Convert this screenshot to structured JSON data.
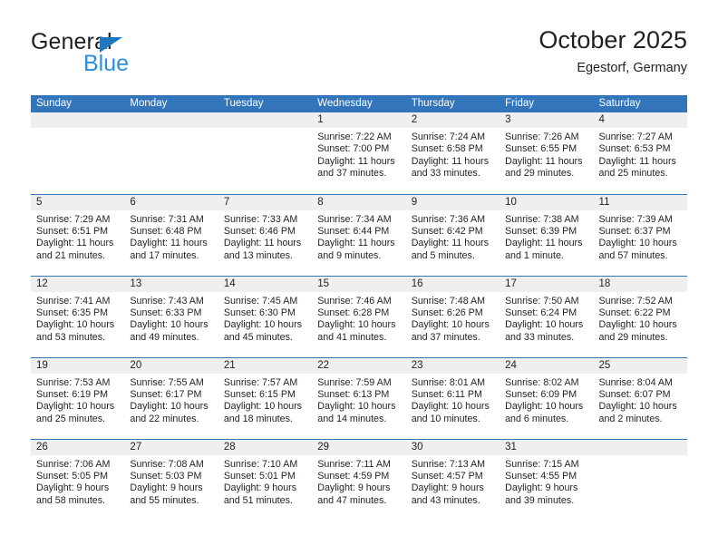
{
  "brand": {
    "word_general": "General",
    "word_blue": "Blue",
    "triangle_color": "#1f77bd",
    "blue_color": "#2f8ed6"
  },
  "header": {
    "title": "October 2025",
    "subtitle": "Egestorf, Germany"
  },
  "theme": {
    "header_blue": "#3275ba",
    "daynum_band": "#efefef",
    "text": "#231f20"
  },
  "weekdays": [
    "Sunday",
    "Monday",
    "Tuesday",
    "Wednesday",
    "Thursday",
    "Friday",
    "Saturday"
  ],
  "labels": {
    "sunrise": "Sunrise:",
    "sunset": "Sunset:",
    "daylight": "Daylight:"
  },
  "weeks": [
    [
      {
        "empty": true
      },
      {
        "empty": true
      },
      {
        "empty": true
      },
      {
        "day": "1",
        "sunrise": "Sunrise: 7:22 AM",
        "sunset": "Sunset: 7:00 PM",
        "daylight": "Daylight: 11 hours and 37 minutes."
      },
      {
        "day": "2",
        "sunrise": "Sunrise: 7:24 AM",
        "sunset": "Sunset: 6:58 PM",
        "daylight": "Daylight: 11 hours and 33 minutes."
      },
      {
        "day": "3",
        "sunrise": "Sunrise: 7:26 AM",
        "sunset": "Sunset: 6:55 PM",
        "daylight": "Daylight: 11 hours and 29 minutes."
      },
      {
        "day": "4",
        "sunrise": "Sunrise: 7:27 AM",
        "sunset": "Sunset: 6:53 PM",
        "daylight": "Daylight: 11 hours and 25 minutes."
      }
    ],
    [
      {
        "day": "5",
        "sunrise": "Sunrise: 7:29 AM",
        "sunset": "Sunset: 6:51 PM",
        "daylight": "Daylight: 11 hours and 21 minutes."
      },
      {
        "day": "6",
        "sunrise": "Sunrise: 7:31 AM",
        "sunset": "Sunset: 6:48 PM",
        "daylight": "Daylight: 11 hours and 17 minutes."
      },
      {
        "day": "7",
        "sunrise": "Sunrise: 7:33 AM",
        "sunset": "Sunset: 6:46 PM",
        "daylight": "Daylight: 11 hours and 13 minutes."
      },
      {
        "day": "8",
        "sunrise": "Sunrise: 7:34 AM",
        "sunset": "Sunset: 6:44 PM",
        "daylight": "Daylight: 11 hours and 9 minutes."
      },
      {
        "day": "9",
        "sunrise": "Sunrise: 7:36 AM",
        "sunset": "Sunset: 6:42 PM",
        "daylight": "Daylight: 11 hours and 5 minutes."
      },
      {
        "day": "10",
        "sunrise": "Sunrise: 7:38 AM",
        "sunset": "Sunset: 6:39 PM",
        "daylight": "Daylight: 11 hours and 1 minute."
      },
      {
        "day": "11",
        "sunrise": "Sunrise: 7:39 AM",
        "sunset": "Sunset: 6:37 PM",
        "daylight": "Daylight: 10 hours and 57 minutes."
      }
    ],
    [
      {
        "day": "12",
        "sunrise": "Sunrise: 7:41 AM",
        "sunset": "Sunset: 6:35 PM",
        "daylight": "Daylight: 10 hours and 53 minutes."
      },
      {
        "day": "13",
        "sunrise": "Sunrise: 7:43 AM",
        "sunset": "Sunset: 6:33 PM",
        "daylight": "Daylight: 10 hours and 49 minutes."
      },
      {
        "day": "14",
        "sunrise": "Sunrise: 7:45 AM",
        "sunset": "Sunset: 6:30 PM",
        "daylight": "Daylight: 10 hours and 45 minutes."
      },
      {
        "day": "15",
        "sunrise": "Sunrise: 7:46 AM",
        "sunset": "Sunset: 6:28 PM",
        "daylight": "Daylight: 10 hours and 41 minutes."
      },
      {
        "day": "16",
        "sunrise": "Sunrise: 7:48 AM",
        "sunset": "Sunset: 6:26 PM",
        "daylight": "Daylight: 10 hours and 37 minutes."
      },
      {
        "day": "17",
        "sunrise": "Sunrise: 7:50 AM",
        "sunset": "Sunset: 6:24 PM",
        "daylight": "Daylight: 10 hours and 33 minutes."
      },
      {
        "day": "18",
        "sunrise": "Sunrise: 7:52 AM",
        "sunset": "Sunset: 6:22 PM",
        "daylight": "Daylight: 10 hours and 29 minutes."
      }
    ],
    [
      {
        "day": "19",
        "sunrise": "Sunrise: 7:53 AM",
        "sunset": "Sunset: 6:19 PM",
        "daylight": "Daylight: 10 hours and 25 minutes."
      },
      {
        "day": "20",
        "sunrise": "Sunrise: 7:55 AM",
        "sunset": "Sunset: 6:17 PM",
        "daylight": "Daylight: 10 hours and 22 minutes."
      },
      {
        "day": "21",
        "sunrise": "Sunrise: 7:57 AM",
        "sunset": "Sunset: 6:15 PM",
        "daylight": "Daylight: 10 hours and 18 minutes."
      },
      {
        "day": "22",
        "sunrise": "Sunrise: 7:59 AM",
        "sunset": "Sunset: 6:13 PM",
        "daylight": "Daylight: 10 hours and 14 minutes."
      },
      {
        "day": "23",
        "sunrise": "Sunrise: 8:01 AM",
        "sunset": "Sunset: 6:11 PM",
        "daylight": "Daylight: 10 hours and 10 minutes."
      },
      {
        "day": "24",
        "sunrise": "Sunrise: 8:02 AM",
        "sunset": "Sunset: 6:09 PM",
        "daylight": "Daylight: 10 hours and 6 minutes."
      },
      {
        "day": "25",
        "sunrise": "Sunrise: 8:04 AM",
        "sunset": "Sunset: 6:07 PM",
        "daylight": "Daylight: 10 hours and 2 minutes."
      }
    ],
    [
      {
        "day": "26",
        "sunrise": "Sunrise: 7:06 AM",
        "sunset": "Sunset: 5:05 PM",
        "daylight": "Daylight: 9 hours and 58 minutes."
      },
      {
        "day": "27",
        "sunrise": "Sunrise: 7:08 AM",
        "sunset": "Sunset: 5:03 PM",
        "daylight": "Daylight: 9 hours and 55 minutes."
      },
      {
        "day": "28",
        "sunrise": "Sunrise: 7:10 AM",
        "sunset": "Sunset: 5:01 PM",
        "daylight": "Daylight: 9 hours and 51 minutes."
      },
      {
        "day": "29",
        "sunrise": "Sunrise: 7:11 AM",
        "sunset": "Sunset: 4:59 PM",
        "daylight": "Daylight: 9 hours and 47 minutes."
      },
      {
        "day": "30",
        "sunrise": "Sunrise: 7:13 AM",
        "sunset": "Sunset: 4:57 PM",
        "daylight": "Daylight: 9 hours and 43 minutes."
      },
      {
        "day": "31",
        "sunrise": "Sunrise: 7:15 AM",
        "sunset": "Sunset: 4:55 PM",
        "daylight": "Daylight: 9 hours and 39 minutes."
      },
      {
        "empty": true
      }
    ]
  ]
}
